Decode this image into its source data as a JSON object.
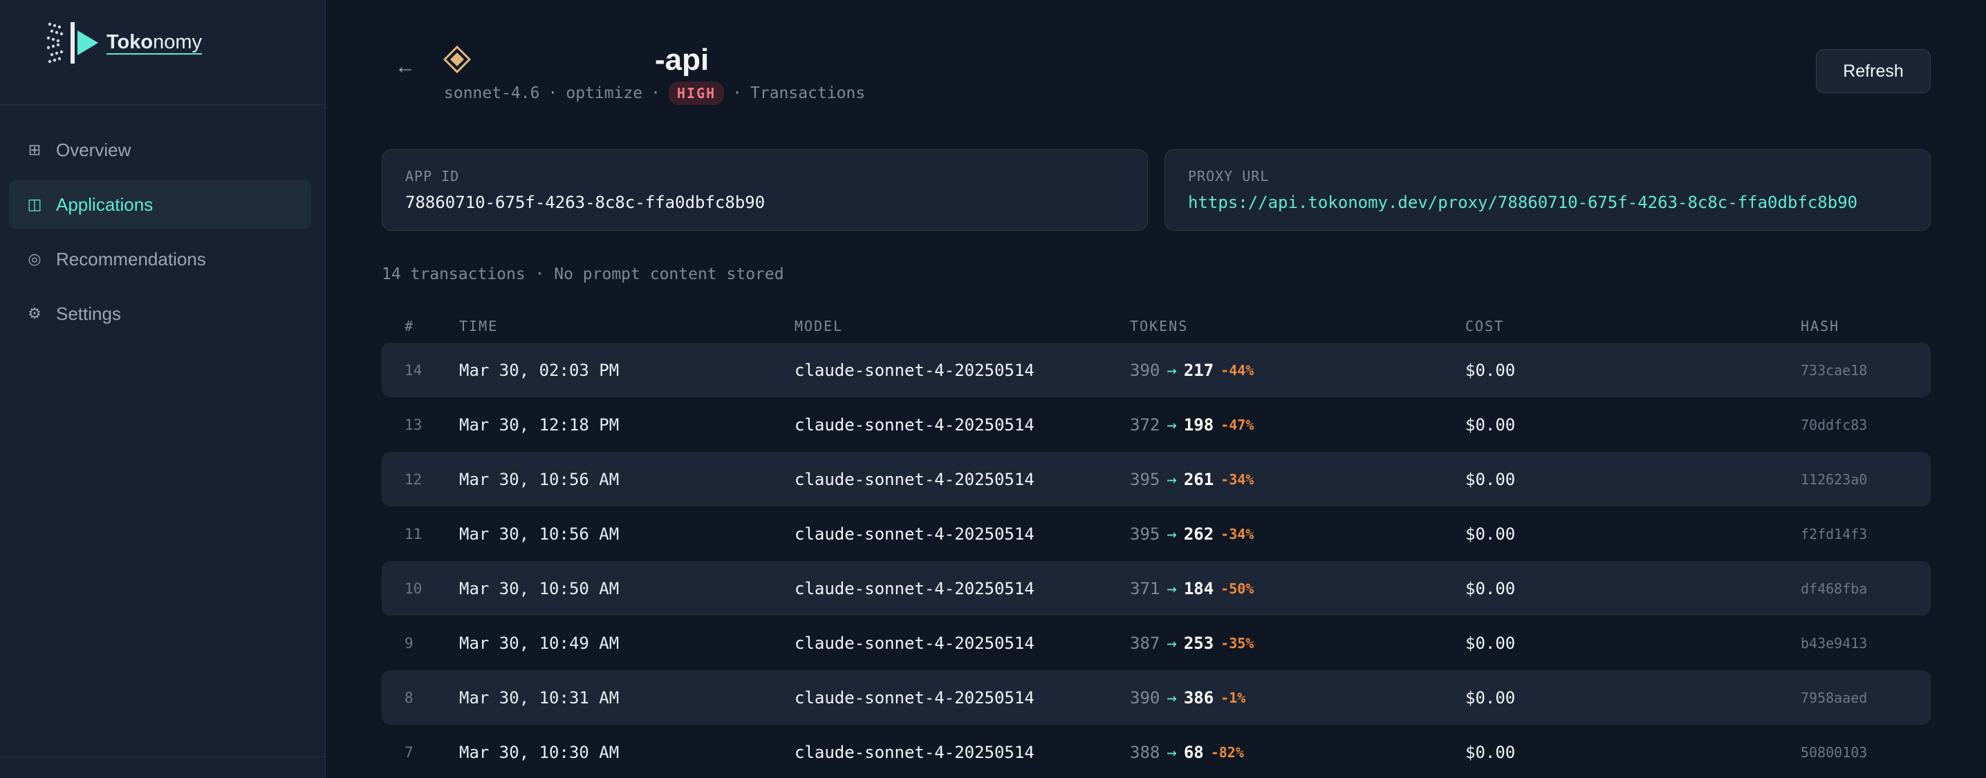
{
  "brand": {
    "name_bold": "Toko",
    "name_rest": "nomy"
  },
  "sidebar": {
    "items": [
      {
        "label": "Overview",
        "icon": "grid-icon",
        "glyph": "⊞"
      },
      {
        "label": "Applications",
        "icon": "app-window-icon",
        "glyph": "◫"
      },
      {
        "label": "Recommendations",
        "icon": "target-icon",
        "glyph": "◎"
      },
      {
        "label": "Settings",
        "icon": "gear-icon",
        "glyph": "⚙"
      }
    ]
  },
  "header": {
    "back_glyph": "←",
    "title": "-api",
    "model": "sonnet-4.6",
    "dot1": "·",
    "mode": "optimize",
    "dot2": "·",
    "badge": "HIGH",
    "dot3": "·",
    "section": "Transactions",
    "refresh_label": "Refresh"
  },
  "cards": {
    "app_id_label": "APP ID",
    "app_id": "78860710-675f-4263-8c8c-ffa0dbfc8b90",
    "proxy_label": "PROXY URL",
    "proxy_url": "https://api.tokonomy.dev/proxy/78860710-675f-4263-8c8c-ffa0dbfc8b90"
  },
  "summary": "14 transactions · No prompt content stored",
  "table": {
    "columns": [
      "#",
      "TIME",
      "MODEL",
      "TOKENS",
      "COST",
      "HASH"
    ],
    "rows": [
      {
        "n": "14",
        "time": "Mar 30, 02:03 PM",
        "model": "claude-sonnet-4-20250514",
        "tin": "390",
        "arrow": "→",
        "tout": "217",
        "pct": "-44%",
        "cost": "$0.00",
        "hash": "733cae18"
      },
      {
        "n": "13",
        "time": "Mar 30, 12:18 PM",
        "model": "claude-sonnet-4-20250514",
        "tin": "372",
        "arrow": "→",
        "tout": "198",
        "pct": "-47%",
        "cost": "$0.00",
        "hash": "70ddfc83"
      },
      {
        "n": "12",
        "time": "Mar 30, 10:56 AM",
        "model": "claude-sonnet-4-20250514",
        "tin": "395",
        "arrow": "→",
        "tout": "261",
        "pct": "-34%",
        "cost": "$0.00",
        "hash": "112623a0"
      },
      {
        "n": "11",
        "time": "Mar 30, 10:56 AM",
        "model": "claude-sonnet-4-20250514",
        "tin": "395",
        "arrow": "→",
        "tout": "262",
        "pct": "-34%",
        "cost": "$0.00",
        "hash": "f2fd14f3"
      },
      {
        "n": "10",
        "time": "Mar 30, 10:50 AM",
        "model": "claude-sonnet-4-20250514",
        "tin": "371",
        "arrow": "→",
        "tout": "184",
        "pct": "-50%",
        "cost": "$0.00",
        "hash": "df468fba"
      },
      {
        "n": "9",
        "time": "Mar 30, 10:49 AM",
        "model": "claude-sonnet-4-20250514",
        "tin": "387",
        "arrow": "→",
        "tout": "253",
        "pct": "-35%",
        "cost": "$0.00",
        "hash": "b43e9413"
      },
      {
        "n": "8",
        "time": "Mar 30, 10:31 AM",
        "model": "claude-sonnet-4-20250514",
        "tin": "390",
        "arrow": "→",
        "tout": "386",
        "pct": "-1%",
        "cost": "$0.00",
        "hash": "7958aaed"
      },
      {
        "n": "7",
        "time": "Mar 30, 10:30 AM",
        "model": "claude-sonnet-4-20250514",
        "tin": "388",
        "arrow": "→",
        "tout": "68",
        "pct": "-82%",
        "cost": "$0.00",
        "hash": "50800103"
      }
    ]
  },
  "colors": {
    "accent": "#5eead4",
    "badge_bg": "#3a1f28",
    "badge_fg": "#f07a8a",
    "savings": "#f08a3c",
    "background": "#0f1724",
    "sidebar": "#182131"
  }
}
